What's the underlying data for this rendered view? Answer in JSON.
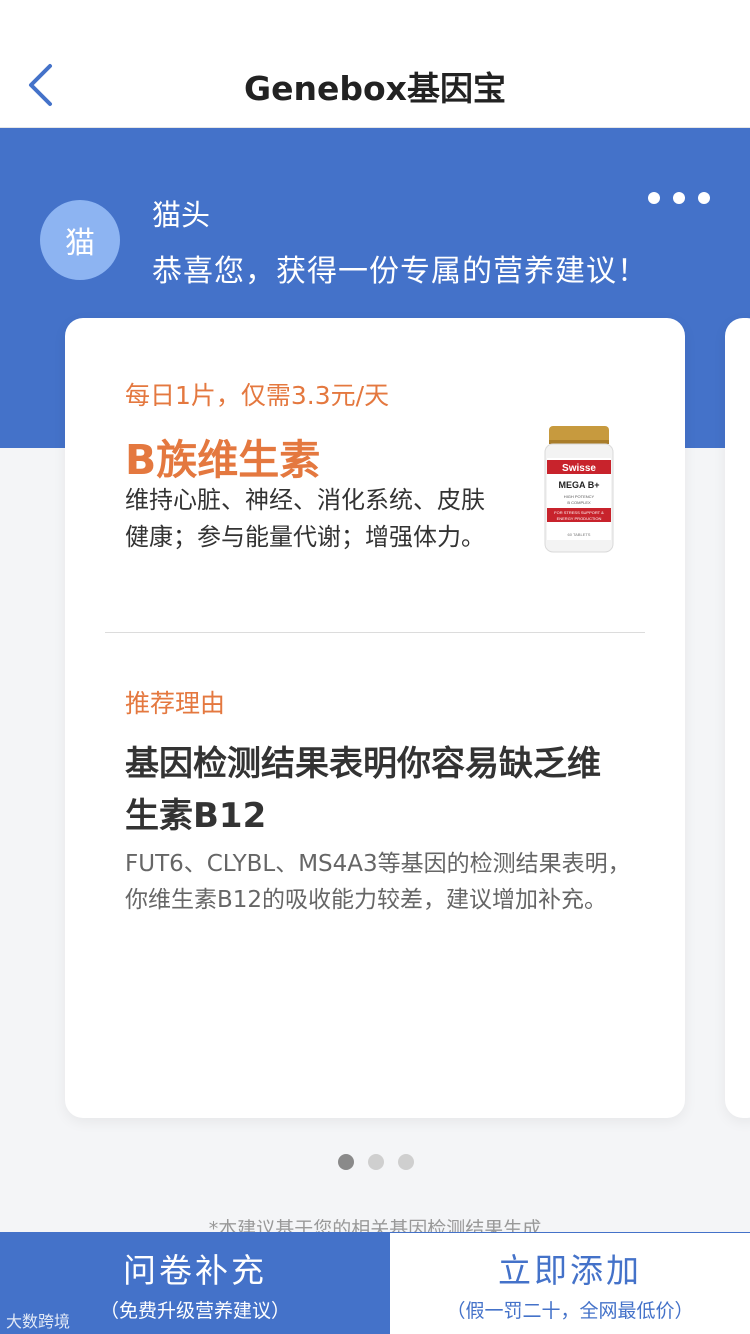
{
  "header": {
    "title": "Genebox基因宝"
  },
  "user": {
    "avatar_text": "猫",
    "name": "猫头",
    "greeting": "恭喜您，获得一份专属的营养建议！"
  },
  "card": {
    "price_note": "每日1片，仅需3.3元/天",
    "product_name": "B族维生素",
    "product_desc": "维持心脏、神经、消化系统、皮肤健康；参与能量代谢；增强体力。",
    "product_image": {
      "brand": "Swisse",
      "name": "MEGA B+",
      "line1": "HIGH POTENCY",
      "line2": "B COMPLEX",
      "line3": "FOR STRESS SUPPORT &",
      "line4": "ENERGY PRODUCTION",
      "count": "60 TABLETS"
    },
    "reason_label": "推荐理由",
    "reason_title": "基因检测结果表明你容易缺乏维生素B12",
    "reason_body": "FUT6、CLYBL、MS4A3等基因的检测结果表明，你维生素B12的吸收能力较差，建议增加补充。"
  },
  "pager": {
    "total": 3,
    "active": 1
  },
  "disclaimer": "*本建议基于您的相关基因检测结果生成",
  "bottom": {
    "left_main": "问卷补充",
    "left_sub": "（免费升级营养建议）",
    "right_main": "立即添加",
    "right_sub": "（假一罚二十，全网最低价）"
  },
  "watermark": "大数跨境",
  "colors": {
    "brand_blue": "#4472c9",
    "accent_orange": "#e4783f",
    "avatar_bg": "#8db4f2"
  },
  "icons": {
    "back": "chevron-left-icon",
    "more": "more-dots-icon"
  }
}
